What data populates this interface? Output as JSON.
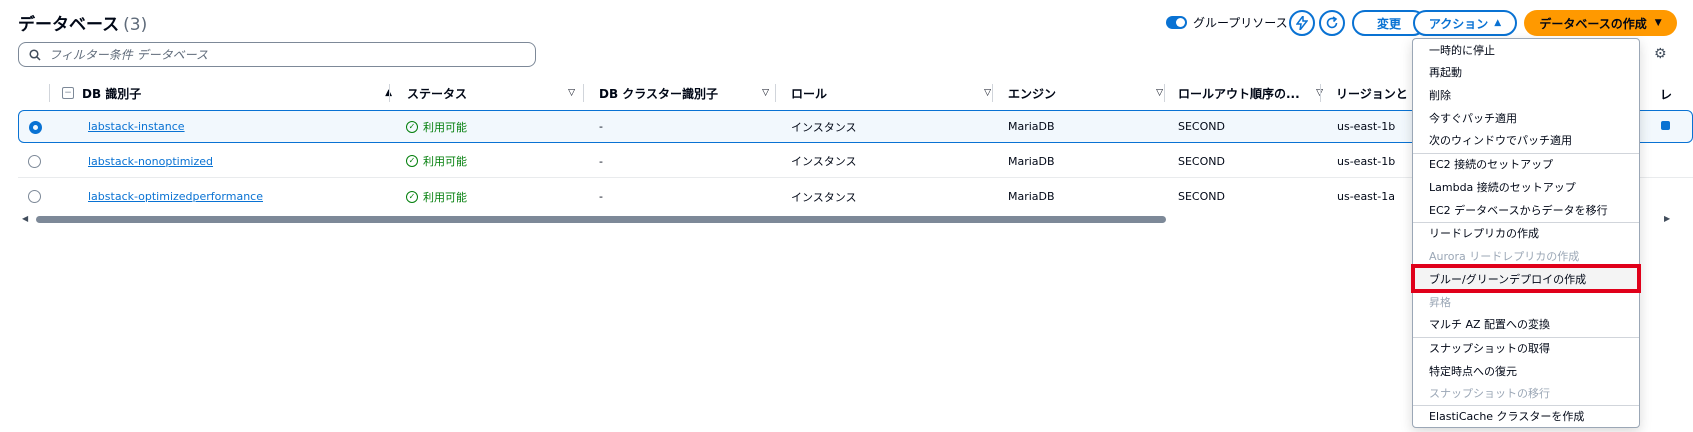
{
  "header": {
    "title": "データベース",
    "count": "(3)",
    "group_toggle_label": "グループリソース",
    "modify_label": "変更",
    "actions_label": "アクション",
    "create_db_label": "データベースの作成"
  },
  "search": {
    "placeholder": "フィルター条件 データベース"
  },
  "table": {
    "columns": [
      "DB 識別子",
      "ステータス",
      "DB クラスター識別子",
      "ロール",
      "エンジン",
      "ロールアウト順序の...",
      "リージョンと AZ"
    ],
    "cut_column": "レ",
    "rows": [
      {
        "id": "labstack-instance",
        "status": "利用可能",
        "cluster": "-",
        "role": "インスタンス",
        "engine": "MariaDB",
        "rollout": "SECOND",
        "region": "us-east-1b"
      },
      {
        "id": "labstack-nonoptimized",
        "status": "利用可能",
        "cluster": "-",
        "role": "インスタンス",
        "engine": "MariaDB",
        "rollout": "SECOND",
        "region": "us-east-1b"
      },
      {
        "id": "labstack-optimizedperformance",
        "status": "利用可能",
        "cluster": "-",
        "role": "インスタンス",
        "engine": "MariaDB",
        "rollout": "SECOND",
        "region": "us-east-1a"
      }
    ]
  },
  "menu": {
    "items": [
      {
        "label": "一時的に停止",
        "disabled": false
      },
      {
        "label": "再起動",
        "disabled": false
      },
      {
        "label": "削除",
        "disabled": false
      },
      {
        "label": "今すぐパッチ適用",
        "disabled": false
      },
      {
        "label": "次のウィンドウでパッチ適用",
        "disabled": false
      },
      {
        "label": "EC2 接続のセットアップ",
        "disabled": false
      },
      {
        "label": "Lambda 接続のセットアップ",
        "disabled": false
      },
      {
        "label": "EC2 データベースからデータを移行",
        "disabled": false
      },
      {
        "label": "リードレプリカの作成",
        "disabled": false
      },
      {
        "label": "Aurora リードレプリカの作成",
        "disabled": true
      },
      {
        "label": "ブルー/グリーンデプロイの作成",
        "disabled": false,
        "highlighted": true
      },
      {
        "label": "昇格",
        "disabled": true
      },
      {
        "label": "マルチ AZ 配置への変換",
        "disabled": false
      },
      {
        "label": "スナップショットの取得",
        "disabled": false
      },
      {
        "label": "特定時点への復元",
        "disabled": false
      },
      {
        "label": "スナップショットの移行",
        "disabled": true
      },
      {
        "label": "ElastiCache クラスターを作成",
        "disabled": false
      }
    ]
  },
  "colors": {
    "accent": "#0972d3",
    "primary": "#ff9900",
    "success": "#037f0c",
    "highlight": "#e0001a"
  }
}
